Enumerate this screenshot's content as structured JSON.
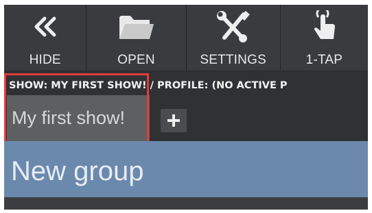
{
  "toolbar": {
    "buttons": [
      {
        "label": "HIDE",
        "icon": "double-chevron-left-icon"
      },
      {
        "label": "OPEN",
        "icon": "folder-icon"
      },
      {
        "label": "SETTINGS",
        "icon": "wrench-screwdriver-icon"
      },
      {
        "label": "1-TAP",
        "icon": "touch-hand-icon"
      }
    ]
  },
  "breadcrumb": {
    "text": "SHOW: MY FIRST SHOW! / PROFILE: (NO ACTIVE P"
  },
  "shows": {
    "active_tab_label": "My first show!",
    "add_label": "+"
  },
  "group": {
    "title": "New group"
  },
  "colors": {
    "toolbar_bg": "#3a3b3e",
    "group_bg": "#6b89ad",
    "highlight": "#e23b3b"
  }
}
